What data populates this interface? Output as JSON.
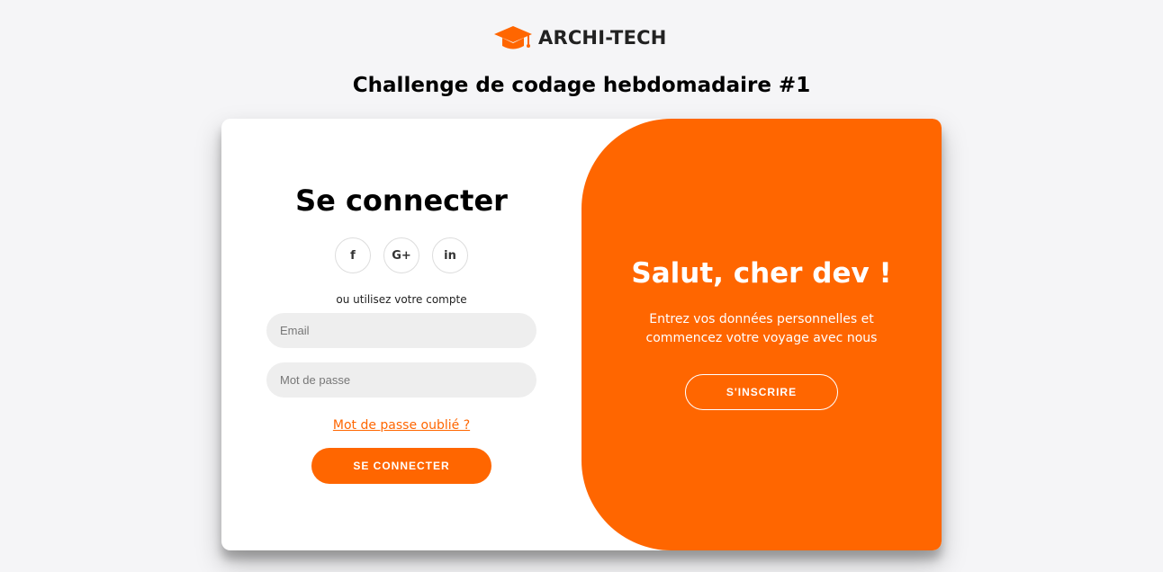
{
  "brand": {
    "name": "ARCHI-TECH",
    "logo_icon": "graduation-cap-icon",
    "accent_color": "#ff6600"
  },
  "page": {
    "title": "Challenge de codage hebdomadaire #1"
  },
  "login": {
    "title": "Se connecter",
    "social": [
      {
        "name": "facebook-icon",
        "glyph": "f"
      },
      {
        "name": "google-plus-icon",
        "glyph": "G+"
      },
      {
        "name": "linkedin-icon",
        "glyph": "in"
      }
    ],
    "alt_text": "ou utilisez votre compte",
    "email_placeholder": "Email",
    "password_placeholder": "Mot de passe",
    "forgot_label": "Mot de passe oublié ?",
    "submit_label": "SE CONNECTER"
  },
  "overlay": {
    "title": "Salut, cher dev !",
    "text": "Entrez vos données personnelles et commencez votre voyage avec nous",
    "button_label": "S'INSCRIRE"
  }
}
